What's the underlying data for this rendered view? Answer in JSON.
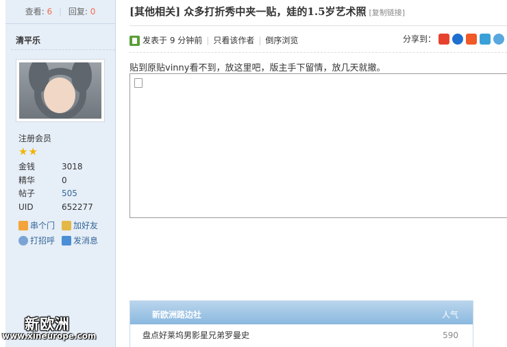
{
  "sidebar": {
    "stats": {
      "views_label": "查看:",
      "views": "6",
      "replies_label": "回复:",
      "replies": "0"
    },
    "username": "清平乐",
    "level": "注册会员",
    "stars": "★★",
    "info": [
      {
        "key": "金钱",
        "value": "3018"
      },
      {
        "key": "精华",
        "value": "0"
      },
      {
        "key": "帖子",
        "value": "505"
      },
      {
        "key": "UID",
        "value": "652277"
      }
    ],
    "actions": [
      {
        "label": "串个门",
        "icon": "home-icon"
      },
      {
        "label": "加好友",
        "icon": "handshake-icon"
      },
      {
        "label": "打招呼",
        "icon": "greet-icon"
      },
      {
        "label": "发消息",
        "icon": "mail-icon"
      }
    ]
  },
  "thread": {
    "title": "[其他相关] 众多打折秀中夹一贴，娃的1.5岁艺术照",
    "copy_link": "[复制链接]",
    "posted": "发表于 9 分钟前",
    "only_author": "只看该作者",
    "reverse": "倒序浏览",
    "share_label": "分享到：",
    "content": "贴到原贴vinny看不到，放这里吧，版主手下留情，放几天就撤。"
  },
  "hot": {
    "title": "新欧洲路边社",
    "popularity_label": "人气",
    "items": [
      {
        "title": "盘点好莱坞男影星兄弟罗曼史",
        "count": "590"
      }
    ]
  },
  "watermark": {
    "cn": "新欧洲",
    "url": "www.xineurope.com"
  },
  "colors": {
    "accent": "#336699",
    "highlight": "#f26c4f",
    "sidebar_bg": "#e6eef7"
  }
}
